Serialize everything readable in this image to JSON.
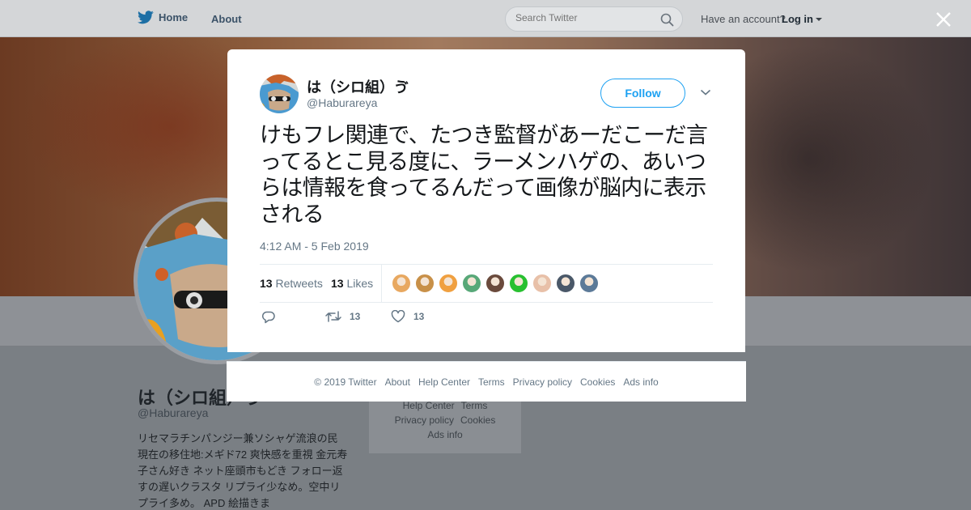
{
  "header": {
    "home_label": "Home",
    "about_label": "About",
    "search_placeholder": "Search Twitter",
    "have_account": "Have an account?",
    "login_label": "Log in"
  },
  "profile": {
    "name": "は（シロ組）ゔ",
    "handle": "@Haburareya",
    "bio": "リセマラチンパンジー兼ソシャゲ流浪の民 現在の移住地:メギド72 爽快感を重視 金元寿子さん好き ネット座頭市もどき フォロー返すの遅いクラスタ リプライ少なめ。空中リプライ多め。 APD 絵描きま"
  },
  "bg_footer": {
    "links": [
      "Help Center",
      "Terms",
      "Privacy policy",
      "Cookies",
      "Ads info"
    ]
  },
  "tweet": {
    "author_name": "は（シロ組）ゔ",
    "author_handle": "@Haburareya",
    "follow_label": "Follow",
    "text": "けもフレ関連で、たつき監督があーだこーだ言ってるとこ見る度に、ラーメンハゲの、あいつらは情報を食ってるんだって画像が脳内に表示される",
    "timestamp": "4:12 AM - 5 Feb 2019",
    "retweets_count": "13",
    "retweets_label": "Retweets",
    "likes_count": "13",
    "likes_label": "Likes",
    "action_retweet_count": "13",
    "action_like_count": "13",
    "liker_colors": [
      "#e8a860",
      "#c89048",
      "#f0a040",
      "#58a878",
      "#6a4a3c",
      "#28c030",
      "#e8c0a8",
      "#4a5868",
      "#5c7a98"
    ]
  },
  "modal_footer": {
    "links": [
      "© 2019 Twitter",
      "About",
      "Help Center",
      "Terms",
      "Privacy policy",
      "Cookies",
      "Ads info"
    ]
  },
  "colors": {
    "accent": "#1da1f2",
    "text_primary": "#14171a",
    "text_secondary": "#657786"
  }
}
